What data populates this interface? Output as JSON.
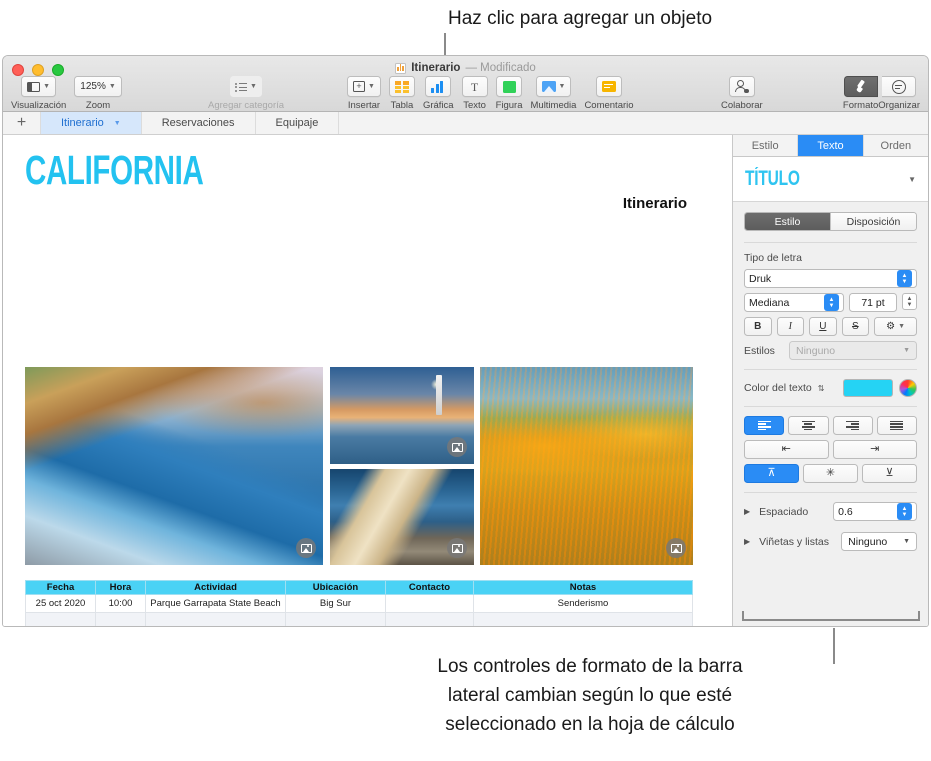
{
  "callouts": {
    "top": "Haz clic para agregar un objeto",
    "bottom_line1": "Los controles de formato de la barra",
    "bottom_line2": "lateral cambian según lo que esté",
    "bottom_line3": "seleccionado en la hoja de cálculo"
  },
  "window": {
    "title": "Itinerario",
    "modified": "— Modificado"
  },
  "toolbar": {
    "left": [
      {
        "label": "Visualización",
        "icon": "view-icon",
        "has_chevron": true
      },
      {
        "label": "Zoom",
        "value": "125%",
        "icon": "zoom-value",
        "has_chevron": true
      }
    ],
    "category": {
      "label": "Agregar categoría",
      "icon": "list-icon",
      "has_chevron": true
    },
    "center": [
      {
        "label": "Insertar",
        "icon": "insert-icon",
        "has_chevron": true
      },
      {
        "label": "Tabla",
        "icon": "table-icon",
        "has_chevron": false
      },
      {
        "label": "Gráfica",
        "icon": "chart-icon",
        "has_chevron": false
      },
      {
        "label": "Texto",
        "icon": "text-icon",
        "has_chevron": false
      },
      {
        "label": "Figura",
        "icon": "shape-icon",
        "has_chevron": false
      },
      {
        "label": "Multimedia",
        "icon": "media-icon",
        "has_chevron": true
      },
      {
        "label": "Comentario",
        "icon": "comment-icon",
        "has_chevron": false
      }
    ],
    "collaborate": {
      "label": "Colaborar",
      "icon": "collaborate-icon"
    },
    "right": [
      {
        "label": "Formato",
        "icon": "brush-icon",
        "active": true
      },
      {
        "label": "Organizar",
        "icon": "arrange-icon",
        "active": false
      }
    ]
  },
  "sheet_tabs": {
    "add": "+",
    "items": [
      {
        "label": "Itinerario",
        "active": true
      },
      {
        "label": "Reservaciones",
        "active": false
      },
      {
        "label": "Equipaje",
        "active": false
      }
    ]
  },
  "document": {
    "heading": "CALIFORNIA",
    "section_label": "Itinerario",
    "photos": [
      {
        "name": "coastal-cliffs-photo",
        "alt": "Acantilados costeros"
      },
      {
        "name": "lighthouse-photo",
        "alt": "Faro al atardecer"
      },
      {
        "name": "sea-lions-photo",
        "alt": "Lobos marinos"
      },
      {
        "name": "poppy-field-photo",
        "alt": "Campo de amapolas"
      }
    ],
    "table": {
      "headers": [
        "Fecha",
        "Hora",
        "Actividad",
        "Ubicación",
        "Contacto",
        "Notas"
      ],
      "rows": [
        [
          "25 oct 2020",
          "10:00",
          "Parque Garrapata State Beach",
          "Big Sur",
          "",
          "Senderismo"
        ],
        [
          "",
          "",
          "",
          "",
          "",
          ""
        ],
        [
          "",
          "",
          "",
          "",
          "",
          ""
        ],
        [
          "",
          "",
          "",
          "",
          "",
          ""
        ],
        [
          "",
          "",
          "",
          "",
          "",
          ""
        ],
        [
          "",
          "",
          "",
          "",
          "",
          ""
        ]
      ]
    }
  },
  "sidebar": {
    "tabs": [
      {
        "label": "Estilo",
        "active": false
      },
      {
        "label": "Texto",
        "active": true
      },
      {
        "label": "Orden",
        "active": false
      }
    ],
    "style_name": "TÍTULO",
    "segmented": [
      {
        "label": "Estilo",
        "active": true
      },
      {
        "label": "Disposición",
        "active": false
      }
    ],
    "font": {
      "section_label": "Tipo de letra",
      "family": "Druk",
      "weight": "Mediana",
      "size": "71 pt",
      "bold": "B",
      "italic": "I",
      "underline": "U",
      "strike": "S",
      "gear": "⚙",
      "styles_label": "Estilos",
      "styles_value": "Ninguno"
    },
    "text_color": {
      "label": "Color del texto",
      "swatch_hex": "#25d3f4"
    },
    "alignment": {
      "horizontal": [
        "left",
        "center",
        "right",
        "justify"
      ],
      "horizontal_active": 0,
      "indent": [
        "decrease",
        "increase"
      ],
      "vertical": [
        "top",
        "middle",
        "bottom"
      ],
      "vertical_active": 0
    },
    "spacing": {
      "label": "Espaciado",
      "value": "0.6"
    },
    "bullets": {
      "label": "Viñetas y listas",
      "value": "Ninguno"
    }
  },
  "colors": {
    "accent_blue": "#2a8cf5",
    "brand_cyan": "#25d3f4",
    "table_header": "#4ad2f5"
  }
}
